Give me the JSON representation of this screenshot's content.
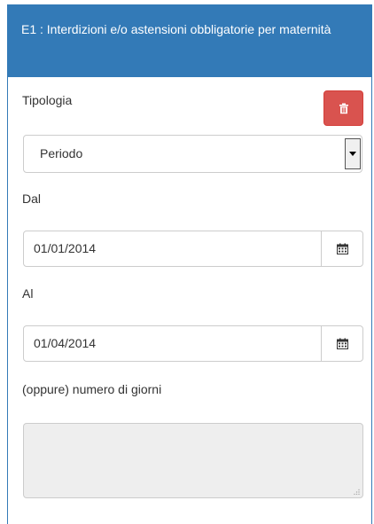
{
  "panel": {
    "title": "E1 : Interdizioni e/o astensioni obbligatorie per maternità",
    "accent_color": "#337ab7"
  },
  "form": {
    "tipologia_label": "Tipologia",
    "tipologia_value": "Periodo",
    "dal_label": "Dal",
    "dal_value": "01/01/2014",
    "al_label": "Al",
    "al_value": "01/04/2014",
    "giorni_label": "(oppure) numero di giorni",
    "giorni_value": ""
  },
  "delete_button": {
    "icon": "trash-icon",
    "color": "#d9534f"
  },
  "calendar_icon": "calendar-icon"
}
